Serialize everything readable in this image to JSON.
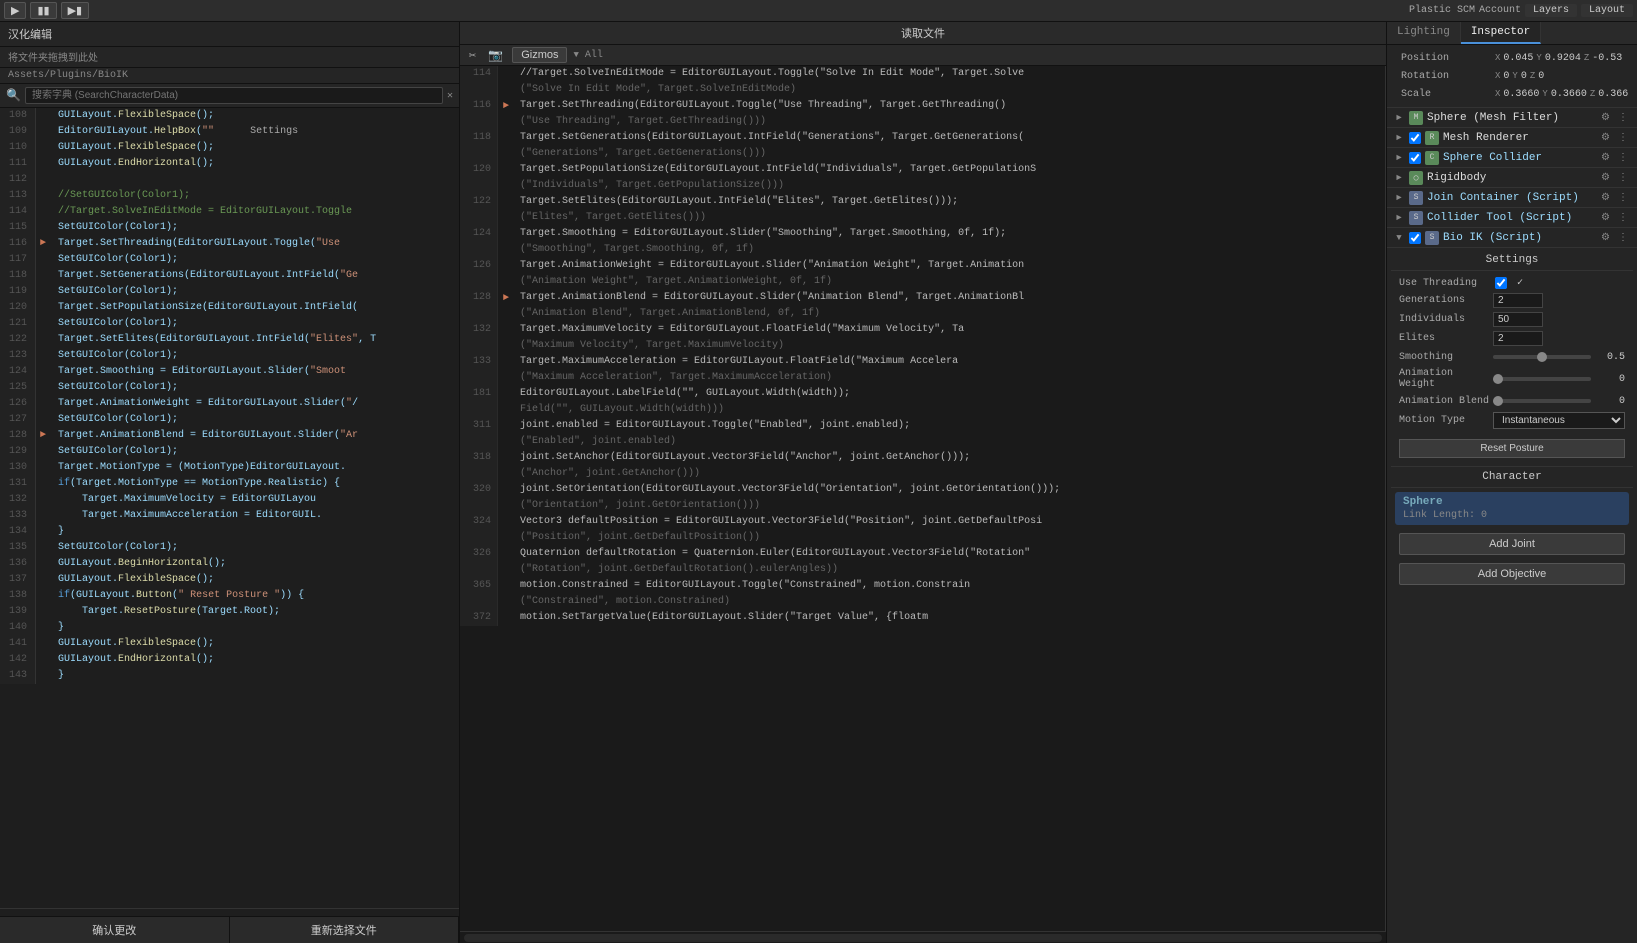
{
  "topbar": {
    "tabs": [
      "Lighting",
      "Inspector"
    ],
    "layers_label": "Layers",
    "layout_label": "Layout",
    "scm_label": "Plastic SCM",
    "account_label": "Account",
    "gizmos_label": "Gizmos",
    "all_label": "All"
  },
  "left_panel": {
    "title": "汉化编辑",
    "drop_hint": "将文件夹拖拽到此处",
    "path": "Assets/Plugins/BioIK",
    "search_placeholder": "搜索字典 (SearchCharacterData)",
    "confirm_btn": "确认更改",
    "reselect_btn": "重新选择文件",
    "lines": [
      {
        "num": "108",
        "content": "GUILayout.FlexibleSpace();",
        "arrow": false
      },
      {
        "num": "109",
        "content": "EditorGUILayout.HelpBox(\"",
        "arrow": false,
        "extra": "Settings"
      },
      {
        "num": "110",
        "content": "GUILayout.FlexibleSpace();",
        "arrow": false
      },
      {
        "num": "111",
        "content": "GUILayout.EndHorizontal();",
        "arrow": false
      },
      {
        "num": "112",
        "content": "",
        "arrow": false
      },
      {
        "num": "113",
        "content": "//SetGUIColor(Color1);",
        "arrow": false
      },
      {
        "num": "114",
        "content": "//Target.SolveInEditMode = EditorGUILayout.Toggle",
        "arrow": false
      },
      {
        "num": "115",
        "content": "SetGUIColor(Color1);",
        "arrow": false
      },
      {
        "num": "116",
        "content": "Target.SetThreading(EditorGUILayout.Toggle(\"Use",
        "arrow": true
      },
      {
        "num": "117",
        "content": "SetGUIColor(Color1);",
        "arrow": false
      },
      {
        "num": "118",
        "content": "Target.SetGenerations(EditorGUILayout.IntField(\"Ge",
        "arrow": false
      },
      {
        "num": "119",
        "content": "SetGUIColor(Color1);",
        "arrow": false
      },
      {
        "num": "120",
        "content": "Target.SetPopulationSize(EditorGUILayout.IntField(",
        "arrow": false
      },
      {
        "num": "121",
        "content": "SetGUIColor(Color1);",
        "arrow": false
      },
      {
        "num": "122",
        "content": "Target.SetElites(EditorGUILayout.IntField(\"Elites\", T",
        "arrow": false
      },
      {
        "num": "123",
        "content": "SetGUIColor(Color1);",
        "arrow": false
      },
      {
        "num": "124",
        "content": "Target.Smoothing = EditorGUILayout.Slider(\"Smoot",
        "arrow": false
      },
      {
        "num": "125",
        "content": "SetGUIColor(Color1);",
        "arrow": false
      },
      {
        "num": "126",
        "content": "Target.AnimationWeight = EditorGUILayout.Slider(\"/",
        "arrow": false
      },
      {
        "num": "127",
        "content": "SetGUIColor(Color1);",
        "arrow": false
      },
      {
        "num": "128",
        "content": "Target.AnimationBlend = EditorGUILayout.Slider(\"Ar",
        "arrow": true
      },
      {
        "num": "129",
        "content": "SetGUIColor(Color1);",
        "arrow": false
      },
      {
        "num": "130",
        "content": "Target.MotionType = (MotionType)EditorGUILayout.",
        "arrow": false
      },
      {
        "num": "131",
        "content": "if(Target.MotionType == MotionType.Realistic) {",
        "arrow": false
      },
      {
        "num": "132",
        "content": "    Target.MaximumVelocity = EditorGUILayou",
        "arrow": false
      },
      {
        "num": "133",
        "content": "    Target.MaximumAcceleration = EditorGUIL.",
        "arrow": false
      },
      {
        "num": "134",
        "content": "}",
        "arrow": false
      },
      {
        "num": "135",
        "content": "SetGUIColor(Color1);",
        "arrow": false
      },
      {
        "num": "136",
        "content": "GUILayout.BeginHorizontal();",
        "arrow": false
      },
      {
        "num": "137",
        "content": "GUILayout.FlexibleSpace();",
        "arrow": false
      },
      {
        "num": "138",
        "content": "if(GUILayout.Button(\"    Reset Posture      \")) {",
        "arrow": false
      },
      {
        "num": "139",
        "content": "    Target.ResetPosture(Target.Root);",
        "arrow": false
      },
      {
        "num": "140",
        "content": "}",
        "arrow": false
      },
      {
        "num": "141",
        "content": "GUILayout.FlexibleSpace();",
        "arrow": false
      },
      {
        "num": "142",
        "content": "GUILayout.EndHorizontal();",
        "arrow": false
      },
      {
        "num": "143",
        "content": "}",
        "arrow": false
      }
    ]
  },
  "mid_panel": {
    "title": "读取文件",
    "left_lines": [
      {
        "num": "114",
        "content": "//Target.SolveInEditMode = EditorGUILayout.Toggle(\"Solve In Edit Mode\", Target.Solve",
        "arrow": false
      },
      {
        "num": "",
        "content": "(\"Solve In Edit Mode\", Target.SolveInEditMode)",
        "arrow": false
      },
      {
        "num": "116",
        "content": "Target.SetThreading(EditorGUILayout.Toggle(\"Use Threading\", Target.GetThreading()",
        "arrow": true
      },
      {
        "num": "",
        "content": "(\"Use Threading\", Target.GetThreading()))",
        "arrow": false
      },
      {
        "num": "118",
        "content": "Target.SetGenerations(EditorGUILayout.IntField(\"Generations\", Target.GetGenerations(",
        "arrow": false
      },
      {
        "num": "",
        "content": "(\"Generations\", Target.GetGenerations()))",
        "arrow": false
      },
      {
        "num": "120",
        "content": "Target.SetPopulationSize(EditorGUILayout.IntField(\"Individuals\", Target.GetPopulationS",
        "arrow": false
      },
      {
        "num": "",
        "content": "(\"Individuals\", Target.GetPopulationSize()))",
        "arrow": false
      },
      {
        "num": "122",
        "content": "Target.SetElites(EditorGUILayout.IntField(\"Elites\", Target.GetElites()));",
        "arrow": false
      },
      {
        "num": "",
        "content": "(\"Elites\", Target.GetElites()))",
        "arrow": false
      },
      {
        "num": "124",
        "content": "Target.Smoothing = EditorGUILayout.Slider(\"Smoothing\", Target.Smoothing, 0f, 1f);",
        "arrow": false
      },
      {
        "num": "",
        "content": "(\"Smoothing\", Target.Smoothing, 0f, 1f)",
        "arrow": false
      },
      {
        "num": "126",
        "content": "Target.AnimationWeight = EditorGUILayout.Slider(\"Animation Weight\", Target.Animation",
        "arrow": false
      },
      {
        "num": "",
        "content": "(\"Animation Weight\", Target.AnimationWeight, 0f, 1f)",
        "arrow": false
      },
      {
        "num": "128",
        "content": "Target.AnimationBlend = EditorGUILayout.Slider(\"Animation Blend\", Target.AnimationBl",
        "arrow": true
      },
      {
        "num": "",
        "content": "(\"Animation Blend\", Target.AnimationBlend, 0f, 1f)",
        "arrow": false
      },
      {
        "num": "132",
        "content": "Target.MaximumVelocity = EditorGUILayout.FloatField(\"Maximum Velocity\", Ta",
        "arrow": false
      },
      {
        "num": "",
        "content": "(\"Maximum Velocity\", Target.MaximumVelocity)",
        "arrow": false
      },
      {
        "num": "133",
        "content": "Target.MaximumAcceleration = EditorGUILayout.FloatField(\"Maximum Accelera",
        "arrow": false
      },
      {
        "num": "",
        "content": "(\"Maximum Acceleration\", Target.MaximumAcceleration)",
        "arrow": false
      },
      {
        "num": "181",
        "content": "EditorGUILayout.LabelField(\"\", GUILayout.Width(width));",
        "arrow": false
      },
      {
        "num": "",
        "content": "Field(\"\", GUILayout.Width(width)))",
        "arrow": false
      },
      {
        "num": "311",
        "content": "joint.enabled = EditorGUILayout.Toggle(\"Enabled\", joint.enabled);",
        "arrow": false
      },
      {
        "num": "",
        "content": "(\"Enabled\", joint.enabled)",
        "arrow": false
      },
      {
        "num": "318",
        "content": "joint.SetAnchor(EditorGUILayout.Vector3Field(\"Anchor\", joint.GetAnchor()));",
        "arrow": false
      },
      {
        "num": "",
        "content": "(\"Anchor\", joint.GetAnchor()))",
        "arrow": false
      },
      {
        "num": "320",
        "content": "joint.SetOrientation(EditorGUILayout.Vector3Field(\"Orientation\", joint.GetOrientation()));",
        "arrow": false
      },
      {
        "num": "",
        "content": "(\"Orientation\", joint.GetOrientation()))",
        "arrow": false
      },
      {
        "num": "324",
        "content": "Vector3 defaultPosition = EditorGUILayout.Vector3Field(\"Position\", joint.GetDefaultPosi",
        "arrow": false
      },
      {
        "num": "",
        "content": "(\"Position\", joint.GetDefaultPosition())",
        "arrow": false
      },
      {
        "num": "326",
        "content": "Quaternion defaultRotation = Quaternion.Euler(EditorGUILayout.Vector3Field(\"Rotation\"",
        "arrow": false
      },
      {
        "num": "",
        "content": "(\"Rotation\", joint.GetDefaultRotation().eulerAngles))",
        "arrow": false
      },
      {
        "num": "365",
        "content": "motion.Constrained = EditorGUILayout.Toggle(\"Constrained\", motion.Constrain",
        "arrow": false
      },
      {
        "num": "",
        "content": "(\"Constrained\", motion.Constrained)",
        "arrow": false
      },
      {
        "num": "372",
        "content": "motion.SetTargetValue(EditorGUILayout.Slider(\"Target Value\", {floatm",
        "arrow": false
      }
    ]
  },
  "inspector": {
    "active_tab": "Inspector",
    "lighting_tab": "Lighting",
    "position": {
      "x": "0.045",
      "y": "0.9204",
      "z": "-0.53"
    },
    "rotation": {
      "x": "X 0",
      "y": "Y 0",
      "z": "Z 0"
    },
    "scale": {
      "x": "0.3660",
      "y": "0.3660",
      "z": "0.366"
    },
    "components": [
      {
        "icon": "mesh",
        "name": "Sphere (Mesh Filter)",
        "color": "#5a8a5a",
        "enabled": null
      },
      {
        "icon": "mesh",
        "name": "Mesh Renderer",
        "color": "#5a8a5a",
        "enabled": true
      },
      {
        "icon": "sphere",
        "name": "Sphere Collider",
        "color": "#5a8a5a",
        "enabled": true
      },
      {
        "icon": "rb",
        "name": "Rigidbody",
        "color": "#5a8a5a",
        "enabled": null
      },
      {
        "icon": "script",
        "name": "Join Container (Script)",
        "color": "#5a6a8a",
        "enabled": null
      },
      {
        "icon": "script",
        "name": "Collider Tool (Script)",
        "color": "#5a6a8a",
        "enabled": null
      },
      {
        "icon": "script",
        "name": "Bio IK (Script)",
        "color": "#5a6a8a",
        "enabled": true
      }
    ],
    "bio_ik_settings": {
      "title": "Settings",
      "use_threading_label": "Use Threading",
      "use_threading_checked": true,
      "generations_label": "Generations",
      "generations_val": "2",
      "individuals_label": "Individuals",
      "individuals_val": "50",
      "elites_label": "Elites",
      "elites_val": "2",
      "smoothing_label": "Smoothing",
      "smoothing_val": "0.5",
      "smoothing_pct": 50,
      "animation_weight_label": "Animation Weight",
      "animation_weight_val": "0",
      "animation_weight_pct": 0,
      "animation_blend_label": "Animation Blend",
      "animation_blend_val": "0",
      "animation_blend_pct": 0,
      "motion_type_label": "Motion Type",
      "motion_type_val": "Instantaneous",
      "reset_posture_btn": "Reset Posture",
      "character_title": "Character",
      "sphere_title": "Sphere",
      "link_length": "Link Length: 0",
      "add_joint_btn": "Add Joint",
      "add_objective_btn": "Add Objective"
    }
  }
}
